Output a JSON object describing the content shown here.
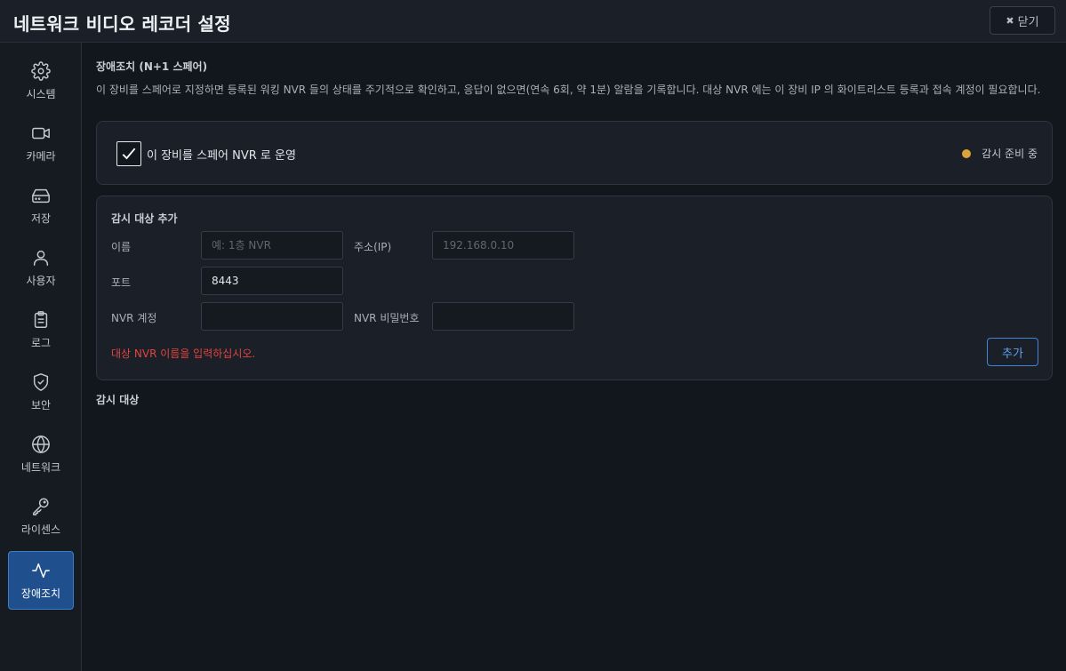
{
  "header": {
    "title": "네트워크 비디오 레코더 설정",
    "close_icon": "close-x-icon",
    "close_label": "닫기"
  },
  "sidebar": {
    "items": [
      {
        "label": "시스템",
        "icon": "gear-icon",
        "active": false
      },
      {
        "label": "카메라",
        "icon": "camera-icon",
        "active": false
      },
      {
        "label": "저장",
        "icon": "hard-drive-icon",
        "active": false
      },
      {
        "label": "사용자",
        "icon": "user-icon",
        "active": false
      },
      {
        "label": "로그",
        "icon": "clipboard-icon",
        "active": false
      },
      {
        "label": "보안",
        "icon": "shield-check-icon",
        "active": false
      },
      {
        "label": "네트워크",
        "icon": "globe-icon",
        "active": false
      },
      {
        "label": "라이센스",
        "icon": "key-icon",
        "active": false
      },
      {
        "label": "장애조치",
        "icon": "activity-icon",
        "active": true
      }
    ]
  },
  "main": {
    "section_title": "장애조치 (N+1 스페어)",
    "description": "이 장비를 스페어로 지정하면 등록된 워킹 NVR 들의 상태를 주기적으로 확인하고, 응답이 없으면(연속 6회, 약 1분) 알람을 기록합니다. 대상 NVR 에는 이 장비 IP 의 화이트리스트 등록과 접속 계정이 필요합니다.",
    "spare_toggle": {
      "label": "이 장비를 스페어 NVR 로 운영",
      "checked": true
    },
    "status": {
      "text": "감시 준비 중",
      "color": "#d9a43a"
    },
    "add_target": {
      "title": "감시 대상 추가",
      "name_label": "이름",
      "name_value": "",
      "name_placeholder": "예: 1층 NVR",
      "address_label": "주소(IP)",
      "address_value": "",
      "address_placeholder": "192.168.0.10",
      "port_label": "포트",
      "port_value": "8443",
      "account_label": "NVR 계정",
      "account_value": "",
      "password_label": "NVR 비밀번호",
      "password_value": "",
      "error_text": "대상 NVR 이름을 입력하십시오.",
      "add_button": "추가"
    },
    "targets_title": "감시 대상"
  },
  "colors": {
    "accent": "#1f4f8c",
    "error": "#e0453e",
    "warning": "#d9a43a"
  }
}
